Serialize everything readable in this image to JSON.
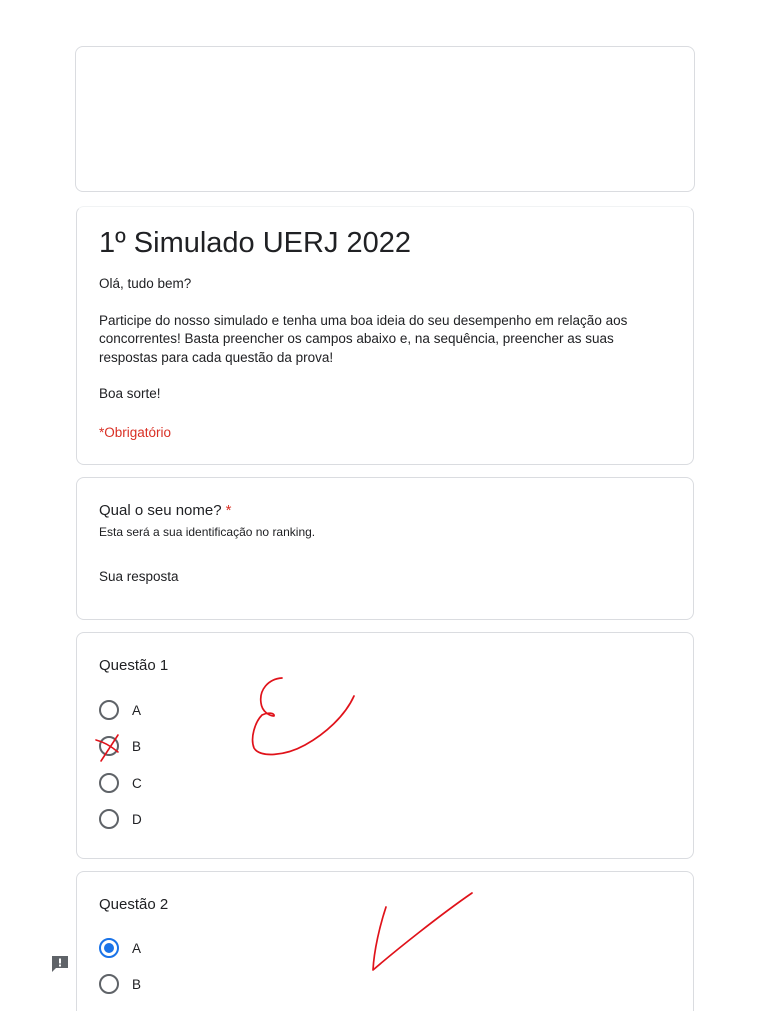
{
  "form": {
    "title": "1º Simulado UERJ 2022",
    "description": [
      "Olá, tudo bem?",
      "Participe do nosso simulado e tenha uma boa ideia do seu desempenho em relação aos concorrentes! Basta preencher os campos abaixo e, na sequência, preencher as suas respostas para cada questão da prova!",
      "Boa sorte!"
    ],
    "required_note": "*Obrigatório"
  },
  "name_question": {
    "title": "Qual o seu nome?",
    "required_mark": "*",
    "help": "Esta será a sua identificação no ranking.",
    "placeholder": "Sua resposta"
  },
  "question1": {
    "title": "Questão 1",
    "options": [
      "A",
      "B",
      "C",
      "D"
    ],
    "handwritten_mark": "E"
  },
  "question2": {
    "title": "Questão 2",
    "options": [
      "A",
      "B"
    ],
    "selected": "A"
  },
  "colors": {
    "accent": "#1a73e8",
    "required": "#d93025",
    "ink": "#e0121a",
    "border": "#dadce0"
  },
  "icons": {
    "feedback": "report-feedback-icon"
  }
}
